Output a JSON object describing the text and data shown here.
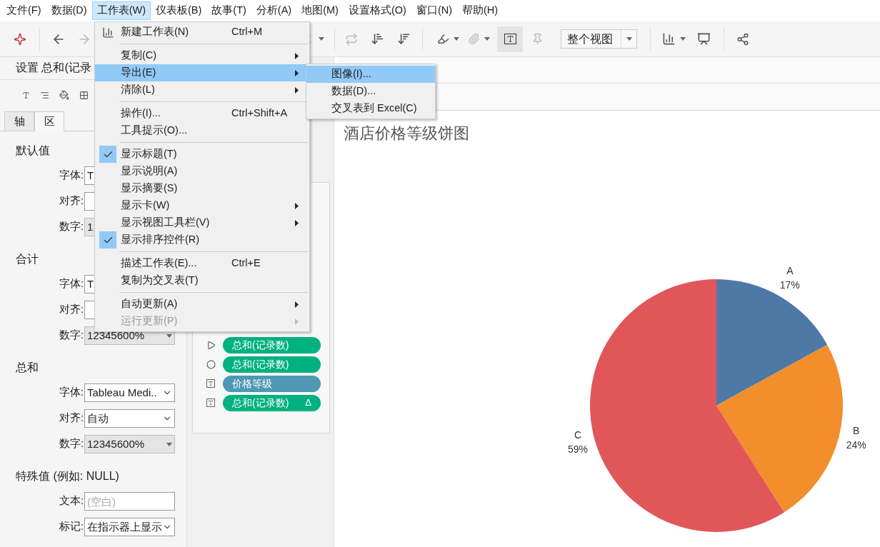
{
  "menubar": [
    {
      "label": "文件(F)",
      "selected": false
    },
    {
      "label": "数据(D)",
      "selected": false
    },
    {
      "label": "工作表(W)",
      "selected": true
    },
    {
      "label": "仪表板(B)",
      "selected": false
    },
    {
      "label": "故事(T)",
      "selected": false
    },
    {
      "label": "分析(A)",
      "selected": false
    },
    {
      "label": "地图(M)",
      "selected": false
    },
    {
      "label": "设置格式(O)",
      "selected": false
    },
    {
      "label": "窗口(N)",
      "selected": false
    },
    {
      "label": "帮助(H)",
      "selected": false
    }
  ],
  "toolbar": {
    "fit_dropdown": "整个视图"
  },
  "format_panel": {
    "title": "设置 总和(记录",
    "tabs": [
      {
        "label": "轴",
        "selected": false
      },
      {
        "label": "区",
        "selected": true
      }
    ],
    "sections": [
      {
        "heading": "默认值",
        "fields": [
          {
            "label": "字体:",
            "kind": "select",
            "value": "T"
          },
          {
            "label": "对齐:",
            "kind": "select"
          },
          {
            "label": "数字:",
            "kind": "number",
            "value": "1"
          }
        ]
      },
      {
        "heading": "合计",
        "fields": [
          {
            "label": "字体:",
            "kind": "select",
            "value": "T"
          },
          {
            "label": "对齐:",
            "kind": "select"
          },
          {
            "label": "数字:",
            "kind": "number",
            "value": "12345600%"
          }
        ]
      },
      {
        "heading": "总和",
        "fields": [
          {
            "label": "字体:",
            "kind": "select",
            "value": "Tableau Medi.."
          },
          {
            "label": "对齐:",
            "kind": "select",
            "value": "自动"
          },
          {
            "label": "数字:",
            "kind": "number",
            "value": "12345600%"
          }
        ]
      },
      {
        "heading": "特殊值 (例如: NULL)",
        "fields": [
          {
            "label": "文本:",
            "kind": "text",
            "placeholder": "(空白)"
          },
          {
            "label": "标记:",
            "kind": "select",
            "value": "在指示器上显示"
          }
        ]
      }
    ]
  },
  "marks": [
    {
      "kind": "angle",
      "label": "总和(记录数)",
      "color": "#00b180"
    },
    {
      "kind": "size",
      "label": "总和(记录数)",
      "color": "#00b180"
    },
    {
      "kind": "label",
      "label": "价格等级",
      "color": "#4e98b4"
    },
    {
      "kind": "label",
      "label": "总和(记录数)",
      "color": "#00b180",
      "badge": "Δ"
    }
  ],
  "worksheet_menu": [
    {
      "kind": "item",
      "label": "新建工作表(N)",
      "shortcut": "Ctrl+M",
      "icon": true,
      "selected": false
    },
    {
      "kind": "separator"
    },
    {
      "kind": "item",
      "label": "复制(C)",
      "submenu": true,
      "selected": false
    },
    {
      "kind": "item",
      "label": "导出(E)",
      "submenu": true,
      "selected": true
    },
    {
      "kind": "item",
      "label": "清除(L)",
      "submenu": true,
      "selected": false
    },
    {
      "kind": "separator"
    },
    {
      "kind": "item",
      "label": "操作(I)...",
      "shortcut": "Ctrl+Shift+A",
      "selected": false
    },
    {
      "kind": "item",
      "label": "工具提示(O)...",
      "selected": false
    },
    {
      "kind": "separator"
    },
    {
      "kind": "item",
      "label": "显示标题(T)",
      "checked": true,
      "selected": false
    },
    {
      "kind": "item",
      "label": "显示说明(A)",
      "checked": false,
      "selected": false
    },
    {
      "kind": "item",
      "label": "显示摘要(S)",
      "checked": false,
      "selected": false
    },
    {
      "kind": "item",
      "label": "显示卡(W)",
      "submenu": true,
      "selected": false
    },
    {
      "kind": "item",
      "label": "显示视图工具栏(V)",
      "submenu": true,
      "selected": false
    },
    {
      "kind": "item",
      "label": "显示排序控件(R)",
      "checked": true,
      "selected": false
    },
    {
      "kind": "separator"
    },
    {
      "kind": "item",
      "label": "描述工作表(E)...",
      "shortcut": "Ctrl+E",
      "selected": false
    },
    {
      "kind": "item",
      "label": "复制为交叉表(T)",
      "selected": false
    },
    {
      "kind": "separator"
    },
    {
      "kind": "item",
      "label": "自动更新(A)",
      "submenu": true,
      "selected": false
    },
    {
      "kind": "item",
      "label": "运行更新(P)",
      "submenu": true,
      "disabled": true,
      "selected": false
    }
  ],
  "export_submenu": [
    {
      "label": "图像(I)...",
      "selected": true
    },
    {
      "label": "数据(D)...",
      "selected": false
    },
    {
      "label": "交叉表到 Excel(C)",
      "selected": false
    }
  ],
  "chart_data": {
    "type": "pie",
    "title": "酒店价格等级饼图",
    "categories": [
      "A",
      "B",
      "C"
    ],
    "values": [
      17,
      24,
      59
    ],
    "colors": [
      "#4e79a7",
      "#f28e2b",
      "#e15759"
    ],
    "value_labels": [
      "17%",
      "24%",
      "59%"
    ]
  }
}
